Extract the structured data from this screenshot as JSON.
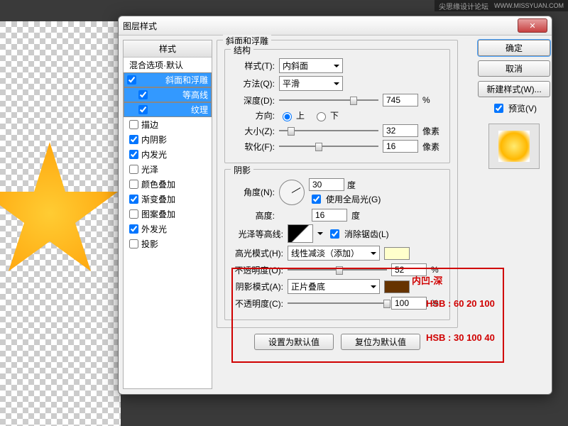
{
  "topbar": {
    "forum": "尖思缘设计论坛",
    "site": "WWW.MISSYUAN.COM"
  },
  "dialog": {
    "title": "图层样式"
  },
  "styles": {
    "header": "样式",
    "blending": "混合选项·默认",
    "bevel": "斜面和浮雕",
    "contour": "等高线",
    "texture": "纹理",
    "stroke": "描边",
    "innerShadow": "内阴影",
    "innerGlow": "内发光",
    "satin": "光泽",
    "colorOverlay": "颜色叠加",
    "gradientOverlay": "渐变叠加",
    "patternOverlay": "图案叠加",
    "outerGlow": "外发光",
    "dropShadow": "投影"
  },
  "checks": {
    "bevel": true,
    "contour": true,
    "texture": true,
    "stroke": false,
    "innerShadow": true,
    "innerGlow": true,
    "satin": false,
    "colorOverlay": false,
    "gradientOverlay": true,
    "patternOverlay": false,
    "outerGlow": true,
    "dropShadow": false
  },
  "panel": {
    "bevel_title": "斜面和浮雕",
    "structure": "结构",
    "style_label": "样式(T):",
    "style_val": "内斜面",
    "technique_label": "方法(Q):",
    "technique_val": "平滑",
    "depth_label": "深度(D):",
    "depth_val": "745",
    "depth_unit": "%",
    "direction_label": "方向:",
    "up": "上",
    "down": "下",
    "size_label": "大小(Z):",
    "size_val": "32",
    "size_unit": "像素",
    "soften_label": "软化(F):",
    "soften_val": "16",
    "soften_unit": "像素",
    "shading": "阴影",
    "angle_label": "角度(N):",
    "angle_val": "30",
    "angle_unit": "度",
    "global": "使用全局光(G)",
    "altitude_label": "高度:",
    "altitude_val": "16",
    "altitude_unit": "度",
    "gloss_label": "光泽等高线:",
    "antialias": "消除锯齿(L)",
    "hilite_label": "高光模式(H):",
    "hilite_val": "线性减淡（添加）",
    "hilite_op_label": "不透明度(O):",
    "hilite_op": "52",
    "op_unit": "%",
    "shadow_label": "阴影模式(A):",
    "shadow_val": "正片叠底",
    "shadow_op_label": "不透明度(C):",
    "shadow_op": "100",
    "reset": "设置为默认值",
    "restore": "复位为默认值"
  },
  "colors": {
    "hilite": "#ffffcc",
    "shadow": "#663300"
  },
  "buttons": {
    "ok": "确定",
    "cancel": "取消",
    "new": "新建样式(W)...",
    "preview": "预览(V)"
  },
  "anno": {
    "contour": "内凹-深",
    "hsb1": "HSB : 60 20 100",
    "hsb2": "HSB : 30 100 40"
  }
}
